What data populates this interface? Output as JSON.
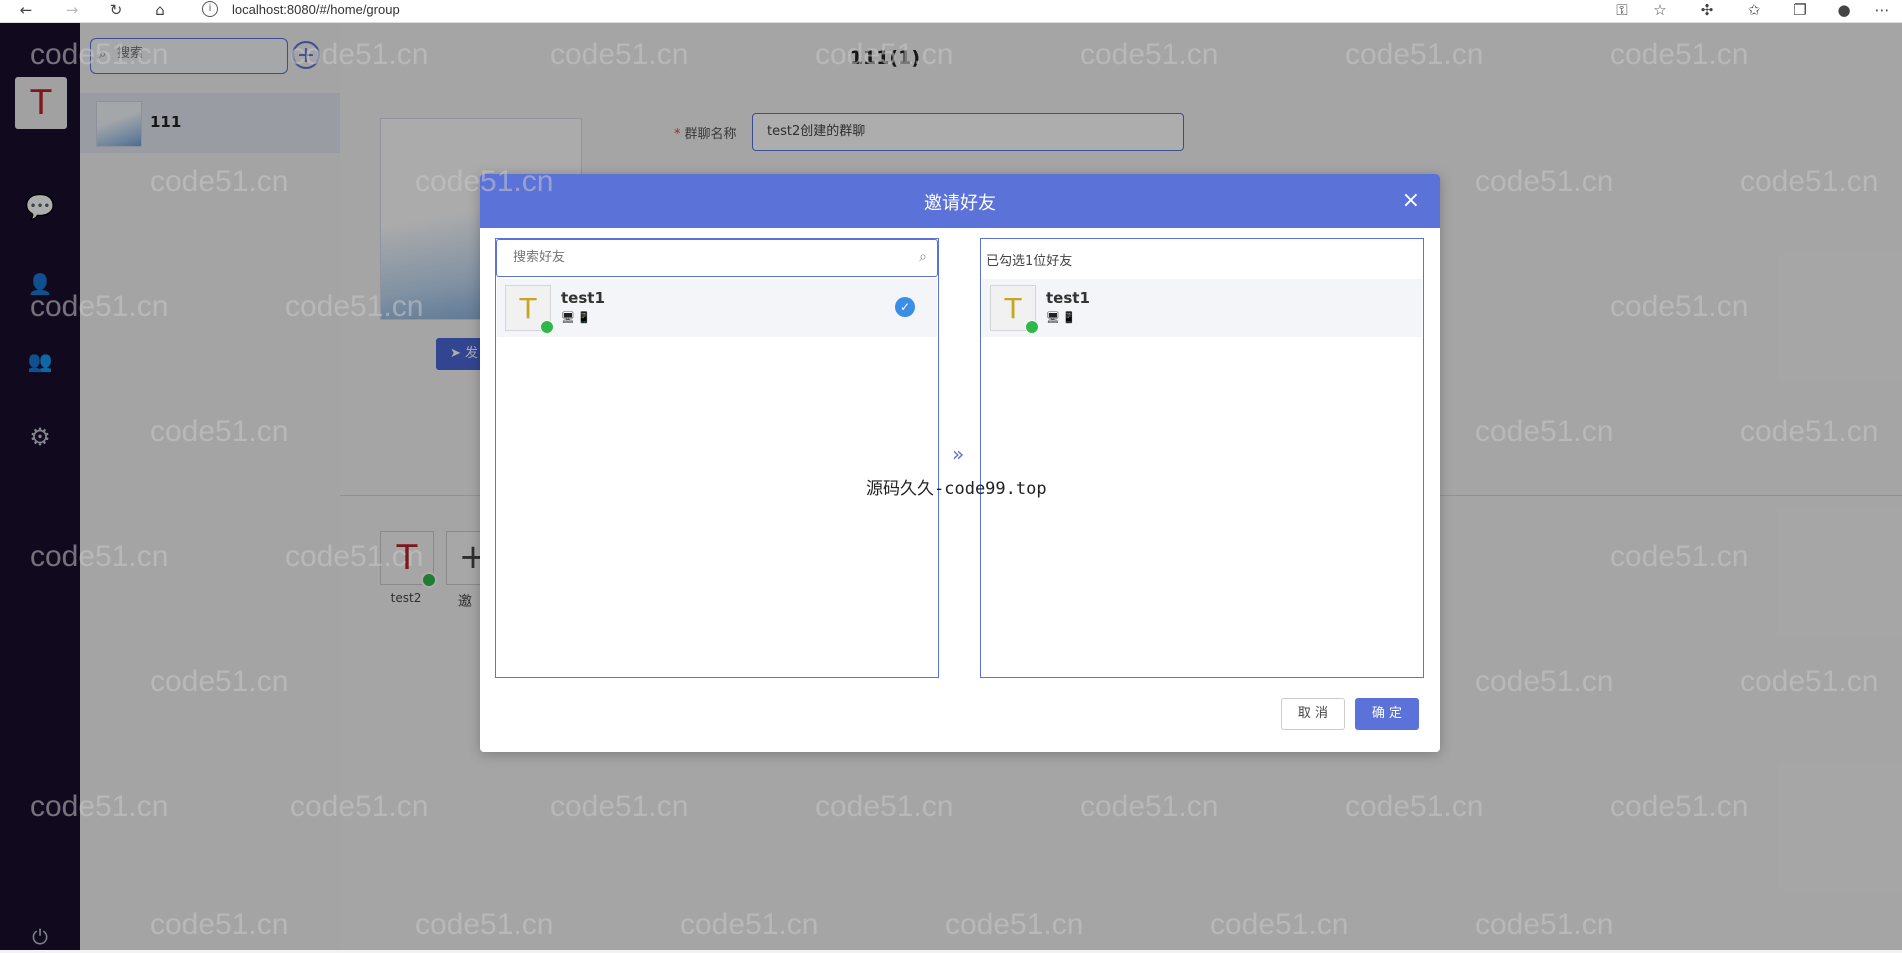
{
  "browser": {
    "url": "localhost:8080/#/home/group"
  },
  "sidebar": {
    "avatar_letter": "T"
  },
  "group_list": {
    "search_placeholder": "搜索",
    "add_icon": "+",
    "groups": [
      {
        "name": "111"
      }
    ]
  },
  "main": {
    "title": "111(1)",
    "form": {
      "name_label": "群聊名称",
      "name_value": "test2创建的群聊",
      "send_label": "发"
    },
    "members": [
      {
        "letter": "T",
        "name": "test2"
      }
    ],
    "invite_label": "邀"
  },
  "dialog": {
    "title": "邀请好友",
    "close": "×",
    "search_placeholder": "搜索好友",
    "selected_count_text": "已勾选1位好友",
    "left_list": [
      {
        "letter": "T",
        "name": "test1",
        "devices": "🖥📱",
        "checked": true
      }
    ],
    "right_list": [
      {
        "letter": "T",
        "name": "test1",
        "devices": "🖥📱"
      }
    ],
    "transfer_icon": "»",
    "cancel_label": "取 消",
    "ok_label": "确 定"
  },
  "overlay_note": "源码久久-code99.top",
  "watermark_text": "code51.cn",
  "colors": {
    "accent": "#5b72d8",
    "rail_bg": "#1a0f2e",
    "online": "#2fb84a",
    "check": "#3a8ee6"
  }
}
